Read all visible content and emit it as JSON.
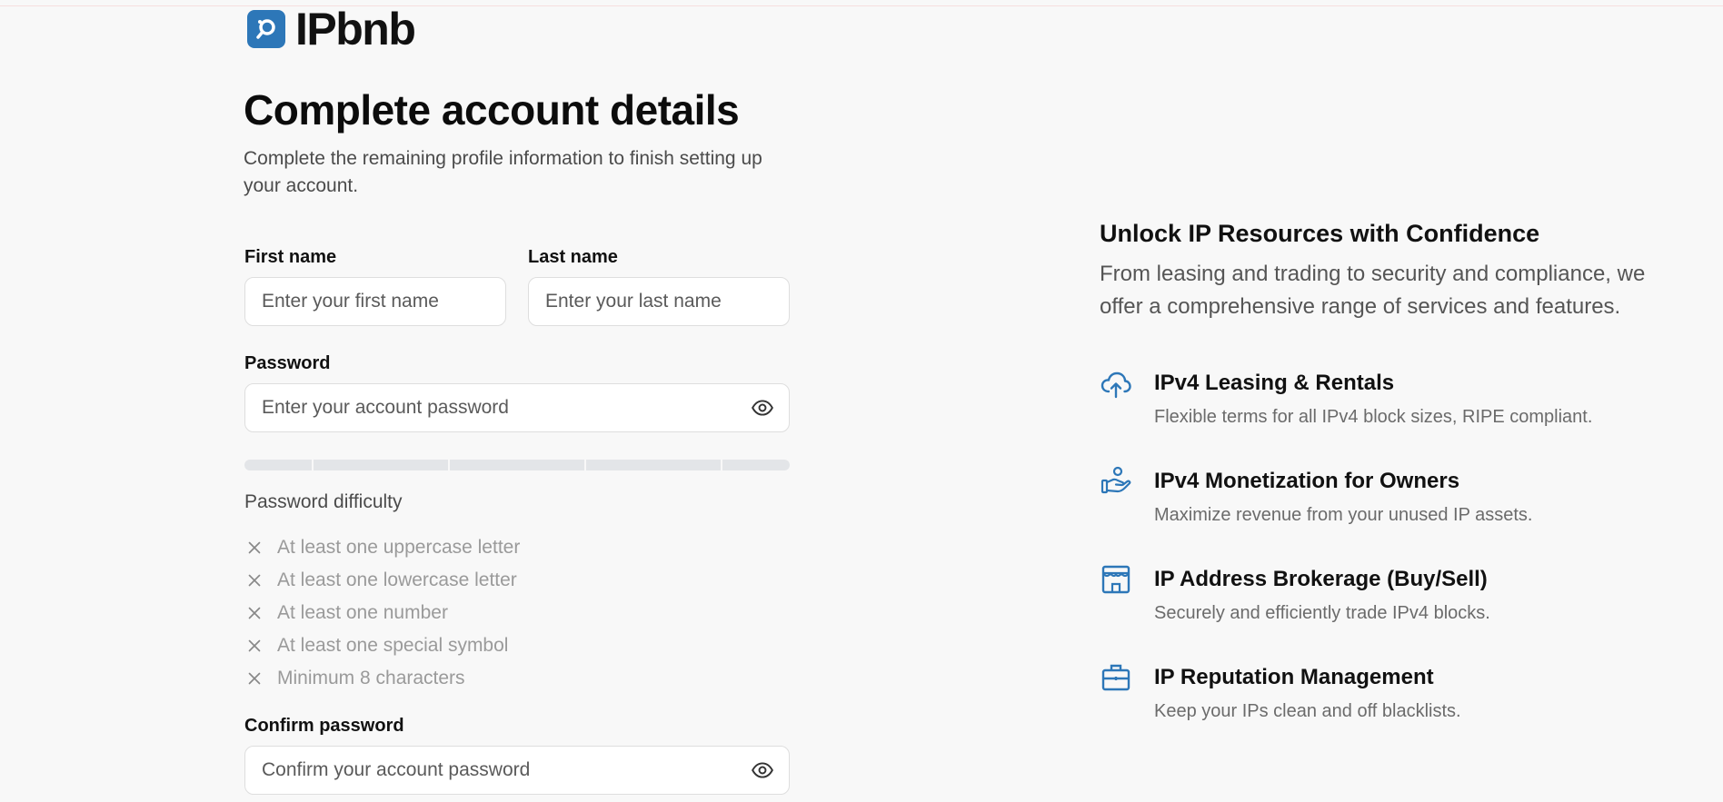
{
  "brand": {
    "name": "IPbnb",
    "accent": "#2d77b8"
  },
  "form": {
    "title": "Complete account details",
    "subtitle": "Complete the remaining profile information to finish setting up your account.",
    "first_name": {
      "label": "First name",
      "placeholder": "Enter your first name"
    },
    "last_name": {
      "label": "Last name",
      "placeholder": "Enter your last name"
    },
    "password": {
      "label": "Password",
      "placeholder": "Enter your account password"
    },
    "difficulty_title": "Password difficulty",
    "rules": [
      "At least one uppercase letter",
      "At least one lowercase letter",
      "At least one number",
      "At least one special symbol",
      "Minimum 8 characters"
    ],
    "strength_fraction": 0,
    "confirm_password": {
      "label": "Confirm password",
      "placeholder": "Confirm your account password"
    }
  },
  "promo": {
    "title": "Unlock IP Resources with Confidence",
    "subtitle": "From leasing and trading to security and compliance, we offer a comprehensive range of services and features.",
    "features": [
      {
        "icon": "cloud-upload-icon",
        "title": "IPv4 Leasing & Rentals",
        "desc": "Flexible terms for all IPv4 block sizes, RIPE compliant."
      },
      {
        "icon": "hand-coins-icon",
        "title": "IPv4 Monetization for Owners",
        "desc": "Maximize revenue from your unused IP assets."
      },
      {
        "icon": "storefront-icon",
        "title": "IP Address Brokerage (Buy/Sell)",
        "desc": "Securely and efficiently trade IPv4 blocks."
      },
      {
        "icon": "briefcase-icon",
        "title": "IP Reputation Management",
        "desc": "Keep your IPs clean and off blacklists."
      }
    ]
  }
}
